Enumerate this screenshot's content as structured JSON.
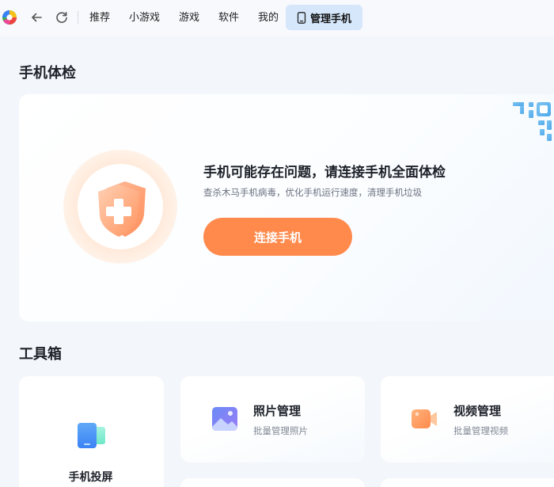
{
  "topbar": {
    "nav": [
      "推荐",
      "小游戏",
      "游戏",
      "软件",
      "我的"
    ],
    "active_tab": "管理手机"
  },
  "checkup": {
    "section_title": "手机体检",
    "title": "手机可能存在问题，请连接手机全面体检",
    "subtitle": "查杀木马手机病毒，优化手机运行速度，清理手机垃圾",
    "button": "连接手机"
  },
  "toolbox": {
    "section_title": "工具箱",
    "cast": {
      "name": "手机投屏"
    },
    "photo": {
      "name": "照片管理",
      "desc": "批量管理照片"
    },
    "video": {
      "name": "视频管理",
      "desc": "批量管理视频"
    }
  },
  "colors": {
    "accent_orange": "#ff8a4c",
    "active_tab_bg": "#d6e7fb",
    "background": "#f3f6fa"
  },
  "icons": [
    "browser-logo-icon",
    "back-arrow-icon",
    "refresh-icon",
    "phone-icon",
    "shield-plus-icon",
    "qr-code-icon",
    "screen-cast-icon",
    "photo-icon",
    "video-icon"
  ]
}
